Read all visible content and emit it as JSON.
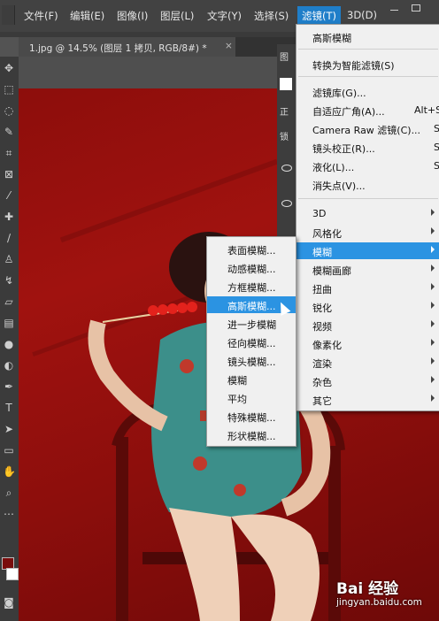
{
  "menubar": {
    "items": [
      {
        "label": "文件(F)"
      },
      {
        "label": "编辑(E)"
      },
      {
        "label": "图像(I)"
      },
      {
        "label": "图层(L)"
      },
      {
        "label": "文字(Y)"
      },
      {
        "label": "选择(S)"
      },
      {
        "label": "滤镜(T)"
      },
      {
        "label": "3D(D)"
      }
    ]
  },
  "document_tab": {
    "title": "1.jpg @ 14.5% (图层 1 拷贝, RGB/8#) *",
    "close": "×"
  },
  "panel": {
    "label_top": "图",
    "label_mid": "正",
    "label_lock": "锁"
  },
  "filter_menu": {
    "items": [
      {
        "label": "高斯模糊",
        "shortcut": ""
      },
      {
        "label": "转换为智能滤镜(S)",
        "shortcut": ""
      },
      {
        "label": "滤镜库(G)...",
        "shortcut": ""
      },
      {
        "label": "自适应广角(A)...",
        "shortcut": "Alt+S"
      },
      {
        "label": "Camera Raw 滤镜(C)...",
        "shortcut": "S"
      },
      {
        "label": "镜头校正(R)...",
        "shortcut": "S"
      },
      {
        "label": "液化(L)...",
        "shortcut": "S"
      },
      {
        "label": "消失点(V)...",
        "shortcut": ""
      },
      {
        "label": "3D",
        "shortcut": ""
      },
      {
        "label": "风格化",
        "shortcut": ""
      },
      {
        "label": "模糊",
        "shortcut": ""
      },
      {
        "label": "模糊画廊",
        "shortcut": ""
      },
      {
        "label": "扭曲",
        "shortcut": ""
      },
      {
        "label": "锐化",
        "shortcut": ""
      },
      {
        "label": "视频",
        "shortcut": ""
      },
      {
        "label": "像素化",
        "shortcut": ""
      },
      {
        "label": "渲染",
        "shortcut": ""
      },
      {
        "label": "杂色",
        "shortcut": ""
      },
      {
        "label": "其它",
        "shortcut": ""
      }
    ]
  },
  "blur_submenu": {
    "items": [
      {
        "label": "表面模糊..."
      },
      {
        "label": "动感模糊..."
      },
      {
        "label": "方框模糊..."
      },
      {
        "label": "高斯模糊..."
      },
      {
        "label": "进一步模糊"
      },
      {
        "label": "径向模糊..."
      },
      {
        "label": "镜头模糊..."
      },
      {
        "label": "模糊"
      },
      {
        "label": "平均"
      },
      {
        "label": "特殊模糊..."
      },
      {
        "label": "形状模糊..."
      }
    ]
  },
  "watermark": {
    "logo": "Bai 经验",
    "url": "jingyan.baidu.com"
  },
  "colors": {
    "accent": "#2b93e2",
    "canvas_red": "#9a110e"
  }
}
